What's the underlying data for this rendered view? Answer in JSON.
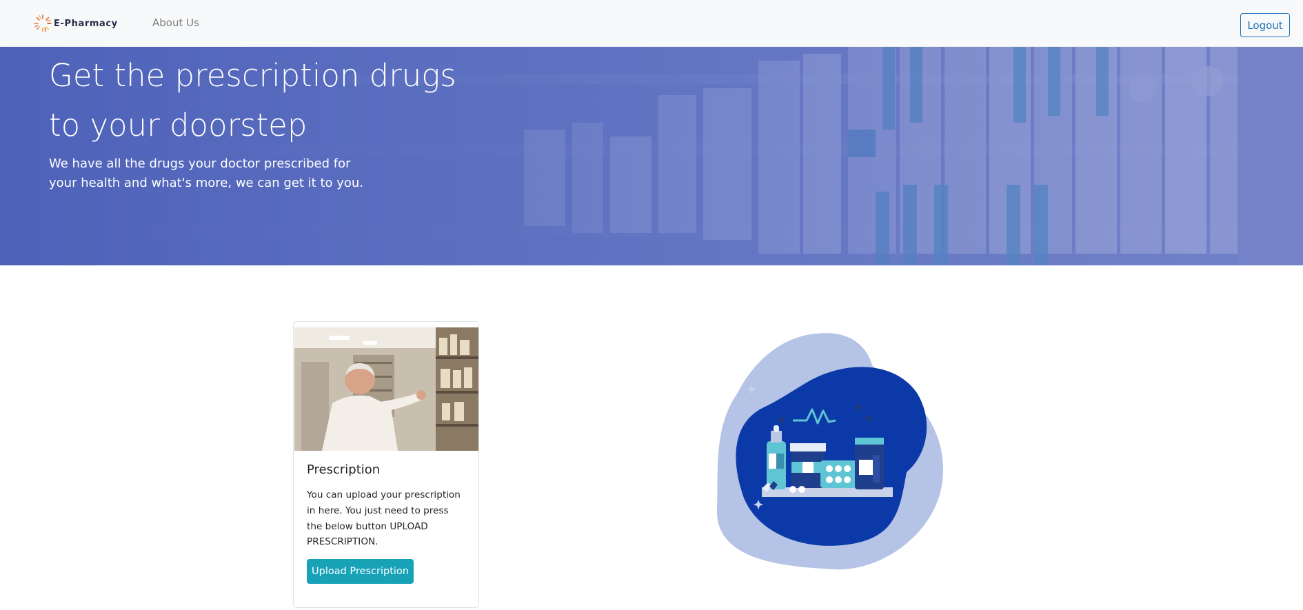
{
  "navbar": {
    "brand": "E-Pharmacy",
    "links": [
      {
        "label": "About Us"
      }
    ],
    "logout_label": "Logout"
  },
  "hero": {
    "title_line1": "Get the prescription drugs",
    "title_line2": "to your doorstep",
    "subtitle": "We have all the drugs your doctor prescribed for your health and what's more, we can get it to you."
  },
  "card": {
    "title": "Prescription",
    "text": "You can upload your prescription in here. You just need to press the below button UPLOAD PRESCRIPTION.",
    "button_label": "Upload Prescription"
  },
  "colors": {
    "accent": "#17a2b8",
    "logout": "#1f6fb5",
    "hero_overlay": "#5468bd",
    "blob_dark": "#0b3aa8",
    "blob_light": "#b4c3e6"
  },
  "icons": {
    "brand_logo": "sunburst-logo-icon"
  }
}
